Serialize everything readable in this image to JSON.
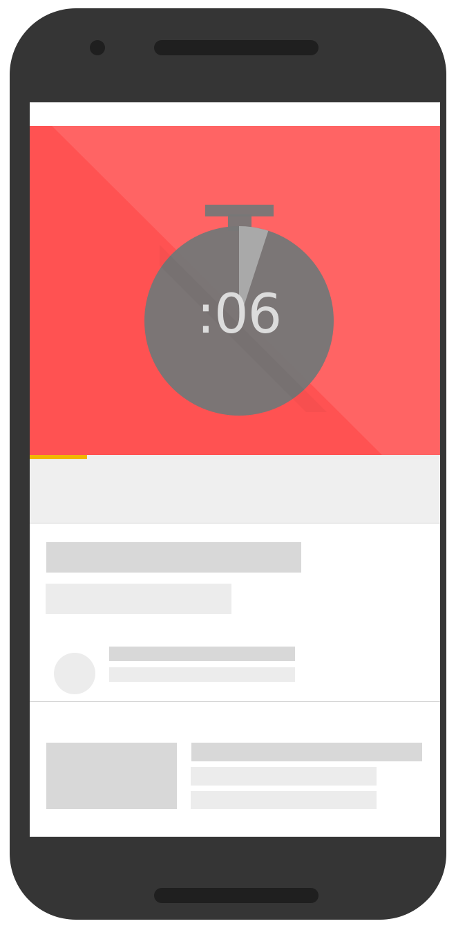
{
  "player": {
    "timer_text": ":06",
    "elapsed_fraction": 0.14,
    "countdown_fraction": 0.05
  },
  "colors": {
    "device_frame": "#353535",
    "video_background": "#ff6464",
    "video_shade": "#ff5252",
    "stopwatch": "#7a7a7a",
    "timer_text": "#dcdcdc",
    "progress_fill": "#f2b600",
    "placeholder_dark": "#d8d8d8",
    "placeholder_light": "#ececec"
  },
  "icons": [
    "stopwatch-icon"
  ]
}
